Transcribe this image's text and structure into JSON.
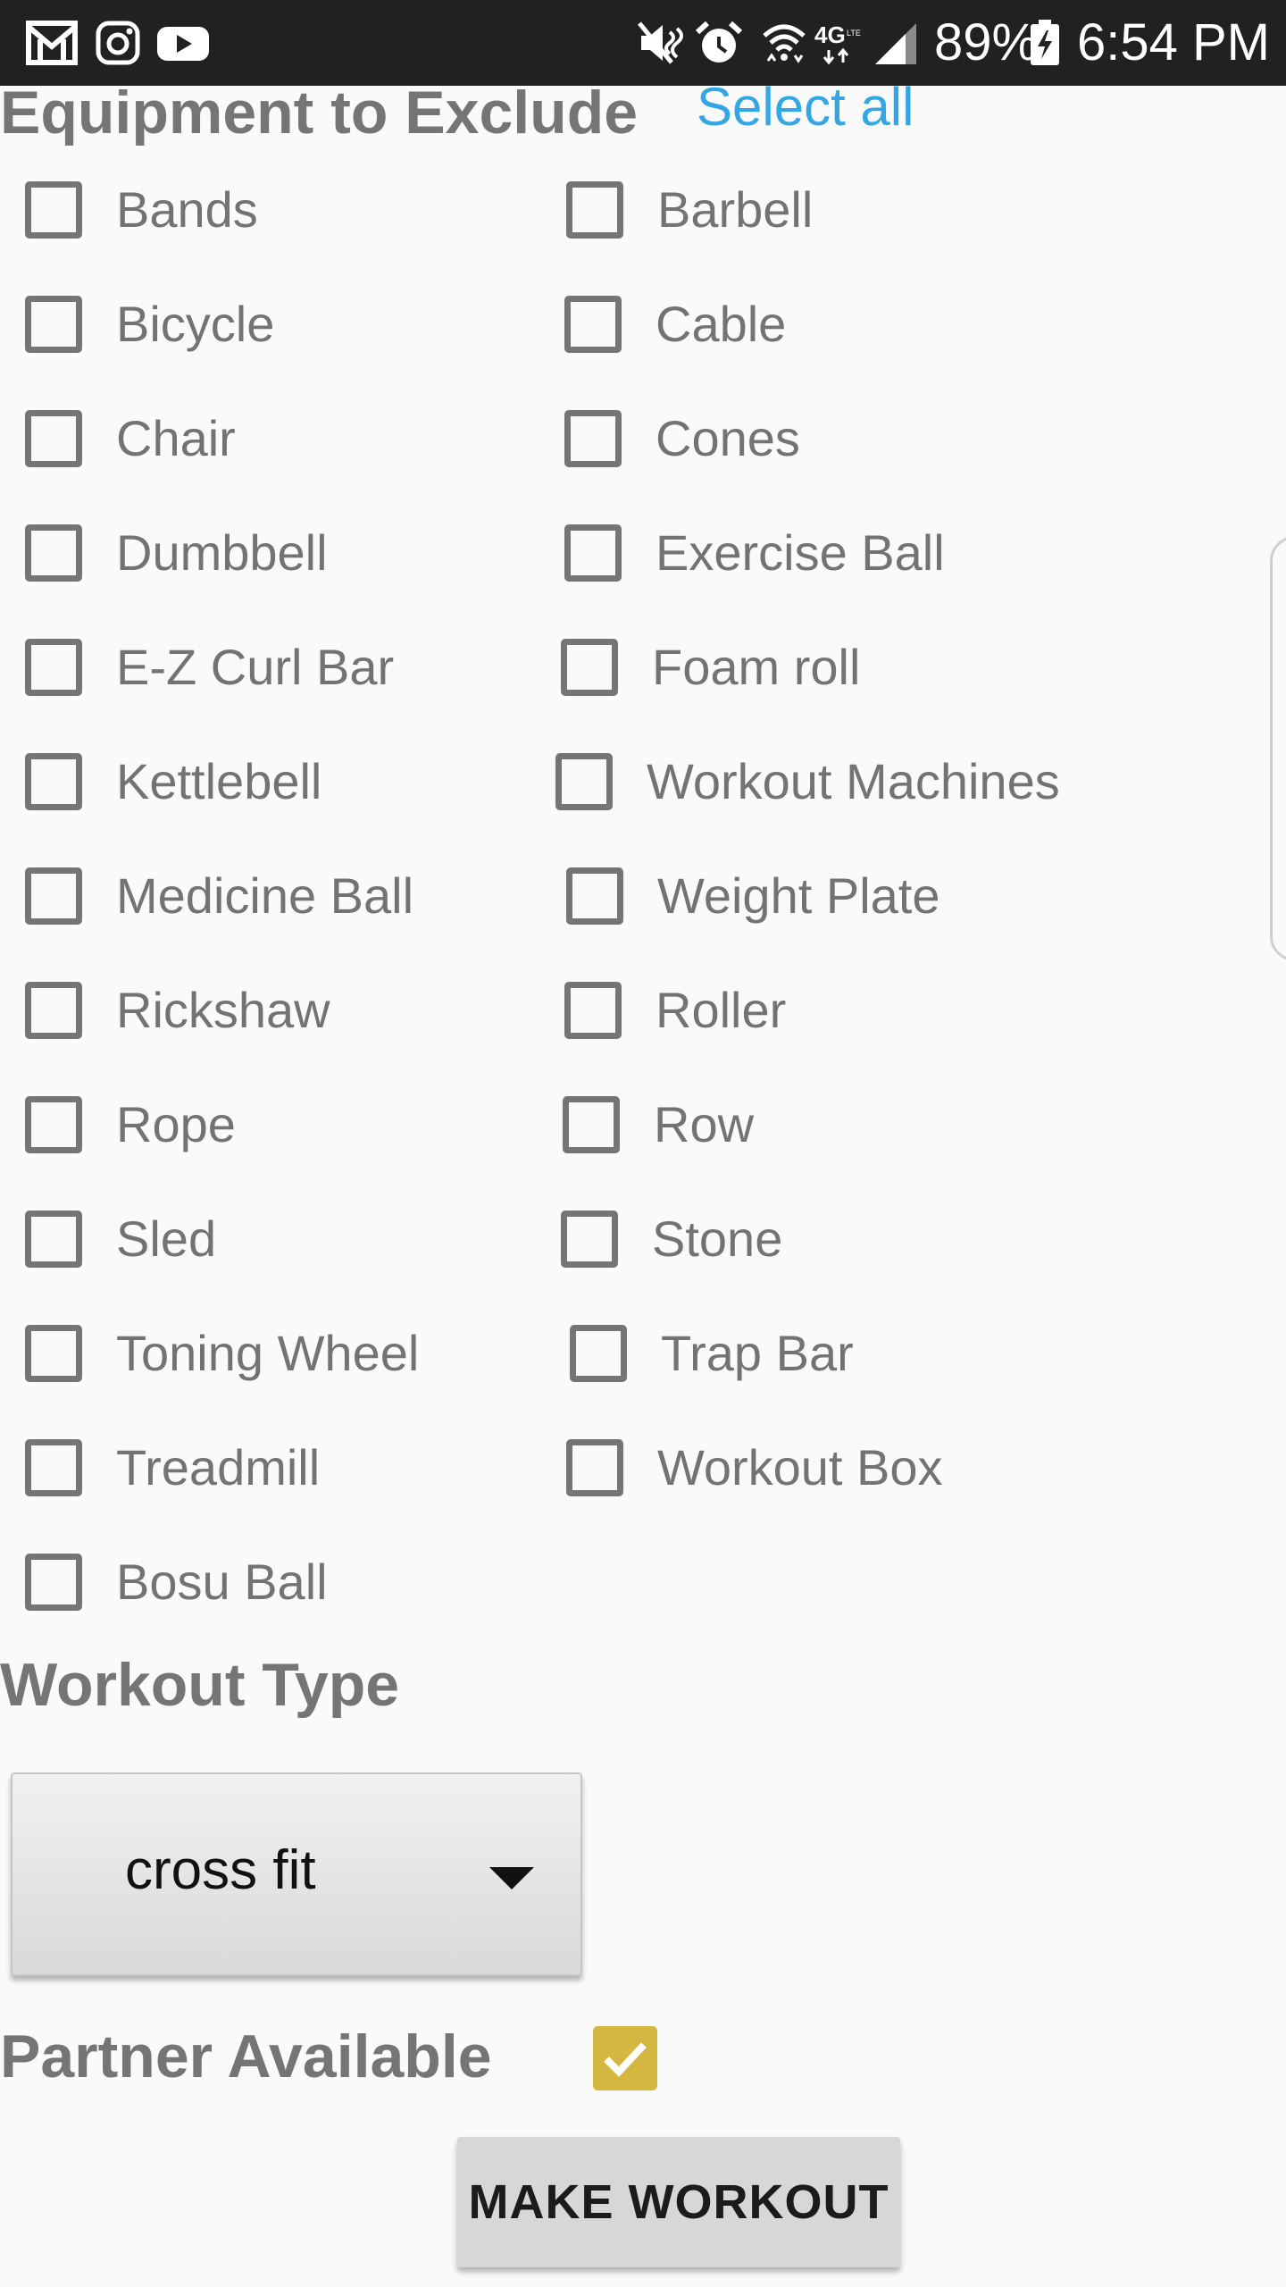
{
  "status_bar": {
    "battery": "89%",
    "time": "6:54 PM",
    "left_icons": [
      "gmail-icon",
      "instagram-icon",
      "youtube-icon"
    ],
    "right_icons": [
      "mute-icon",
      "alarm-icon",
      "wifi-icon",
      "4g-lte-icon",
      "signal-icon",
      "battery-charging-icon"
    ]
  },
  "equipment": {
    "heading": "Equipment to Exclude",
    "select_all": "Select all",
    "items": [
      {
        "label": "Bands",
        "checked": false
      },
      {
        "label": "Barbell",
        "checked": false
      },
      {
        "label": "Bicycle",
        "checked": false
      },
      {
        "label": "Cable",
        "checked": false
      },
      {
        "label": "Chair",
        "checked": false
      },
      {
        "label": "Cones",
        "checked": false
      },
      {
        "label": "Dumbbell",
        "checked": false
      },
      {
        "label": "Exercise Ball",
        "checked": false
      },
      {
        "label": "E-Z Curl Bar",
        "checked": false
      },
      {
        "label": "Foam roll",
        "checked": false
      },
      {
        "label": "Kettlebell",
        "checked": false
      },
      {
        "label": "Workout Machines",
        "checked": false
      },
      {
        "label": "Medicine Ball",
        "checked": false
      },
      {
        "label": "Weight Plate",
        "checked": false
      },
      {
        "label": "Rickshaw",
        "checked": false
      },
      {
        "label": "Roller",
        "checked": false
      },
      {
        "label": "Rope",
        "checked": false
      },
      {
        "label": "Row",
        "checked": false
      },
      {
        "label": "Sled",
        "checked": false
      },
      {
        "label": "Stone",
        "checked": false
      },
      {
        "label": "Toning Wheel",
        "checked": false
      },
      {
        "label": "Trap Bar",
        "checked": false
      },
      {
        "label": "Treadmill",
        "checked": false
      },
      {
        "label": "Workout Box",
        "checked": false
      },
      {
        "label": "Bosu Ball",
        "checked": false
      }
    ]
  },
  "workout_type": {
    "heading": "Workout Type",
    "selected": "cross fit"
  },
  "partner": {
    "heading": "Partner Available",
    "checked": true
  },
  "make_workout_label": "MAKE WORKOUT",
  "colors": {
    "status_bar_bg": "#212121",
    "heading_text": "#757575",
    "link": "#33a6e6",
    "checkbox_border": "#757575",
    "checked_fill": "#d4b740",
    "button_bg": "#d6d7d7"
  }
}
